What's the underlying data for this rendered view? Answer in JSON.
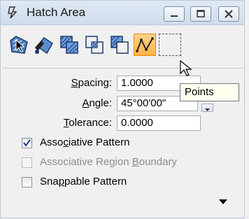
{
  "window": {
    "title": "Hatch Area",
    "icon": "hatch-tool-icon",
    "controls": [
      "minimize-icon",
      "restore-icon",
      "close-icon"
    ]
  },
  "toolbar": {
    "tools": [
      {
        "name": "element-icon"
      },
      {
        "name": "flood-icon"
      },
      {
        "name": "union-icon"
      },
      {
        "name": "intersection-icon"
      },
      {
        "name": "difference-icon"
      },
      {
        "name": "points-icon",
        "active": true
      },
      {
        "name": "fence-icon"
      }
    ],
    "tooltip": "Points"
  },
  "fields": {
    "spacing": {
      "label_pre": "",
      "label_key": "S",
      "label_post": "pacing:",
      "value": "1.0000"
    },
    "angle": {
      "label_pre": "",
      "label_key": "A",
      "label_post": "ngle:",
      "value": "45°00'00\""
    },
    "tolerance": {
      "label_pre": "",
      "label_key": "T",
      "label_post": "olerance:",
      "value": "0.0000"
    }
  },
  "options": {
    "associative_pattern": {
      "pre": "Asso",
      "key": "c",
      "post": "iative Pattern",
      "checked": true,
      "enabled": true
    },
    "associative_region_boundary": {
      "pre": "Associative Region ",
      "key": "B",
      "post": "oundary",
      "checked": false,
      "enabled": false
    },
    "snappable_pattern": {
      "pre": "Sna",
      "key": "p",
      "post": "pable Pattern",
      "checked": false,
      "enabled": true
    }
  },
  "colors": {
    "accent_active": "#ffb347",
    "check_mark": "#1f3a93"
  }
}
